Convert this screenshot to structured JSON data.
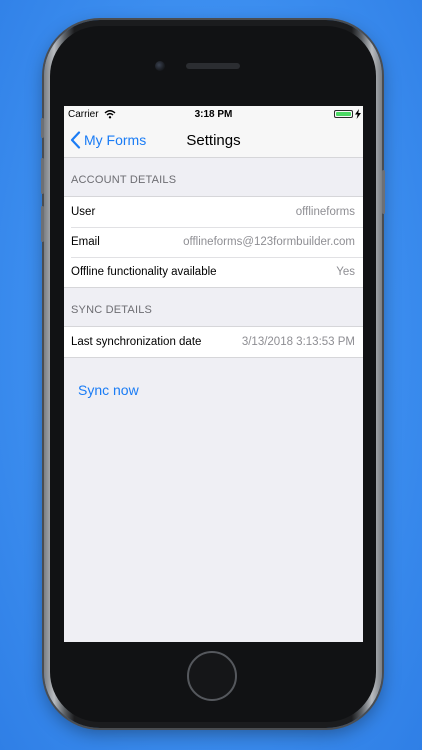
{
  "status_bar": {
    "carrier": "Carrier",
    "time": "3:18 PM",
    "battery_level": 1.0,
    "battery_color": "#4cd964"
  },
  "nav": {
    "back_label": "My Forms",
    "title": "Settings",
    "back_icon": "chevron-left-icon",
    "accent": "#1a7cf5"
  },
  "account": {
    "header": "ACCOUNT DETAILS",
    "rows": [
      {
        "label": "User",
        "value": "offlineforms"
      },
      {
        "label": "Email",
        "value": "offlineforms@123formbuilder.com"
      },
      {
        "label": "Offline functionality available",
        "value": "Yes"
      }
    ]
  },
  "sync": {
    "header": "SYNC DETAILS",
    "rows": [
      {
        "label": "Last synchronization date",
        "value": "3/13/2018 3:13:53 PM"
      }
    ],
    "button_label": "Sync now"
  }
}
